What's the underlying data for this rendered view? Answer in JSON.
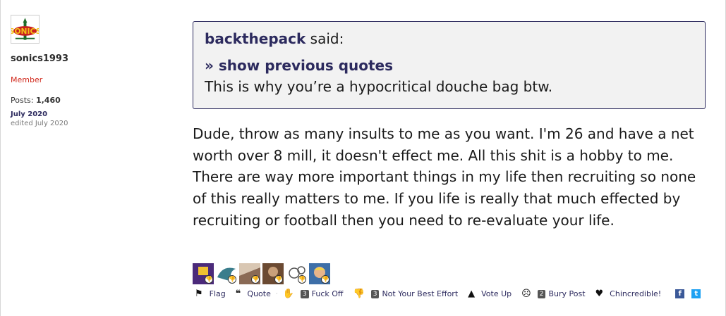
{
  "author": {
    "avatar_icon": "sonics-logo-icon",
    "username": "sonics1993",
    "role": "Member",
    "posts_label": "Posts:",
    "posts_count": "1,460",
    "date": "July 2020",
    "edited": "edited July 2020"
  },
  "quote": {
    "user": "backthepack",
    "said": "said:",
    "show_previous": "» show previous quotes",
    "text": "This is why you’re a hypocritical douche bag btw."
  },
  "body": "Dude, throw as many insults to me as you want. I'm 26 and have a net worth over 8 mill, it doesn't effect me. All this shit is a hobby to me. There are way more important things in my life then recruiting so none of this really matters to me. If you life is really that much effected by recruiting or football then you need to re-evaluate your life.",
  "reaction_avatars": [
    {
      "name": "reactor-avatar-1",
      "badge": "👎"
    },
    {
      "name": "reactor-avatar-2",
      "badge": "👎"
    },
    {
      "name": "reactor-avatar-3",
      "badge": "👎"
    },
    {
      "name": "reactor-avatar-4",
      "badge": "👎"
    },
    {
      "name": "reactor-avatar-5",
      "badge": "👎"
    },
    {
      "name": "reactor-avatar-6",
      "badge": "👎"
    }
  ],
  "reactions": {
    "flag": "Flag",
    "quote": "Quote",
    "fuck_off_count": "3",
    "fuck_off": "Fuck Off",
    "not_best_count": "3",
    "not_best": "Not Your Best Effort",
    "vote_up": "Vote Up",
    "bury_count": "2",
    "bury": "Bury Post",
    "chincredible": "Chincredible!"
  },
  "colors": {
    "accent": "#2c2a5e",
    "role": "#d12a1d",
    "facebook": "#3b5998",
    "twitter": "#1da1f2"
  }
}
